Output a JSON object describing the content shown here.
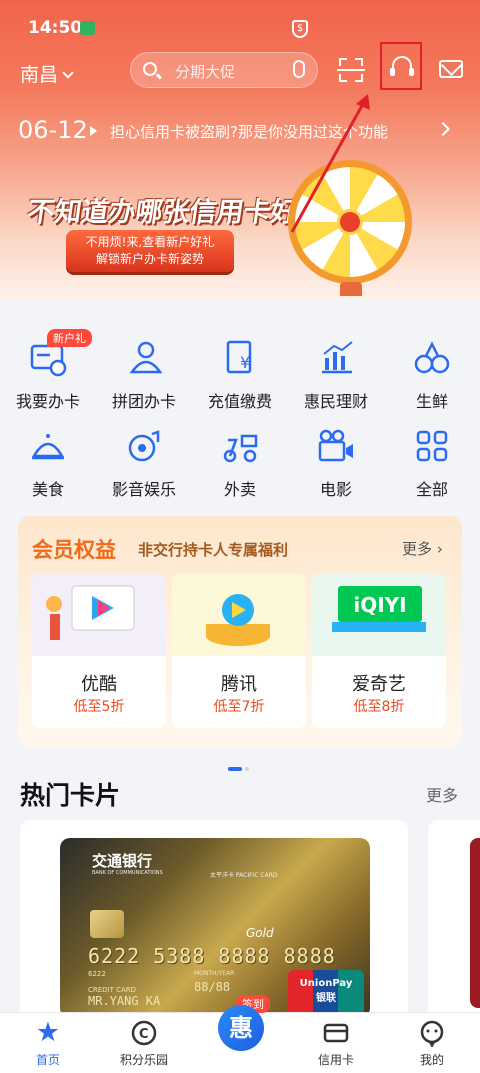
{
  "status_bar": {
    "time": "14:50"
  },
  "topbar": {
    "city": "南昌",
    "search_placeholder": "分期大促"
  },
  "notice": {
    "date": "06-12",
    "text": "担心信用卡被盗刷?那是你没用过这个功能"
  },
  "banner": {
    "title": "不知道办哪张信用卡好?",
    "button_line1": "不用烦!来,查看新户好礼",
    "button_line2": "解锁新户办卡新姿势"
  },
  "grid": {
    "badge": "新户礼",
    "items": [
      {
        "label": "我要办卡",
        "icon": "card-apply-icon"
      },
      {
        "label": "拼团办卡",
        "icon": "group-apply-icon"
      },
      {
        "label": "充值缴费",
        "icon": "payment-icon"
      },
      {
        "label": "惠民理财",
        "icon": "finance-chart-icon"
      },
      {
        "label": "生鲜",
        "icon": "fresh-produce-icon"
      },
      {
        "label": "美食",
        "icon": "food-cloche-icon"
      },
      {
        "label": "影音娱乐",
        "icon": "media-icon"
      },
      {
        "label": "外卖",
        "icon": "delivery-scooter-icon"
      },
      {
        "label": "电影",
        "icon": "movie-camera-icon"
      },
      {
        "label": "全部",
        "icon": "grid-all-icon"
      }
    ]
  },
  "member": {
    "title": "会员权益",
    "subtitle": "非交行持卡人专属福利",
    "more": "更多",
    "cards": [
      {
        "name": "优酷",
        "discount": "低至5折"
      },
      {
        "name": "腾讯",
        "discount": "低至7折"
      },
      {
        "name": "爱奇艺",
        "discount": "低至8折"
      }
    ],
    "iqiyi_logo": "iQIYI"
  },
  "hot_cards": {
    "title": "热门卡片",
    "more": "更多",
    "card": {
      "bank_cn": "交通银行",
      "bank_en": "BANK OF COMMUNICATIONS",
      "sub": "太平洋卡 PACIFIC CARD",
      "tier": "Gold",
      "number": "6222 5388 8888 8888",
      "prefix": "6222",
      "month_year": "MONTH/YEAR",
      "expiry": "88/88",
      "credit_card": "CREDIT CARD",
      "holder": "MR.YANG KA",
      "unionpay": "UnionPay",
      "unionpay_cn": "银联"
    }
  },
  "tabbar": {
    "items": [
      {
        "label": "首页",
        "active": true
      },
      {
        "label": "积分乐园",
        "active": false
      },
      {
        "label": "",
        "active": false
      },
      {
        "label": "信用卡",
        "active": false
      },
      {
        "label": "我的",
        "active": false
      }
    ],
    "sign_badge": "签到",
    "sign_glyph": "惠"
  },
  "colors": {
    "header_red": "#f2644a",
    "accent_blue": "#2a6bf0",
    "discount_orange": "#f04a1a",
    "annotation_red": "#e0202a"
  }
}
